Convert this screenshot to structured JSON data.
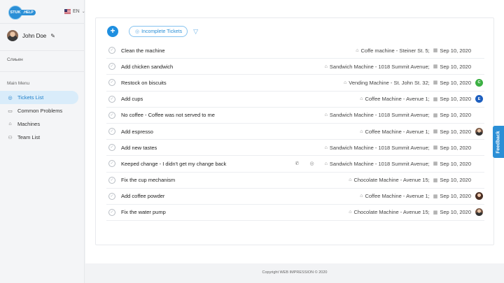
{
  "brand": {
    "badge": "STUK",
    "suffix": ".HELP"
  },
  "language": {
    "code": "EN"
  },
  "user": {
    "name": "John Doe"
  },
  "sidebar": {
    "role": "Слиьен",
    "menu_title": "Main Menu",
    "items": [
      {
        "label": "Tickets List",
        "icon": "check-circle-icon",
        "active": true
      },
      {
        "label": "Common Problems",
        "icon": "folder-icon"
      },
      {
        "label": "Machines",
        "icon": "machine-icon"
      },
      {
        "label": "Team List",
        "icon": "team-icon"
      }
    ]
  },
  "toolbar": {
    "filter_label": "Incomplete Tickets"
  },
  "tickets": [
    {
      "title": "Clean the machine",
      "machine": "Coffe machine - Steiner St. 5;",
      "date": "Sep 10, 2020",
      "assignee": ""
    },
    {
      "title": "Add chicken sandwich",
      "machine": "Sandwich Machine - 1018 Summit Avenue;",
      "date": "Sep 10, 2020",
      "assignee": ""
    },
    {
      "title": "Restock on biscuits",
      "machine": "Vending Machine - St. John St. 32;",
      "date": "Sep 10, 2020",
      "assignee": "C",
      "assignee_color": "#3cb043"
    },
    {
      "title": "Add cups",
      "machine": "Coffee Machine - Avenue 1;",
      "date": "Sep 10, 2020",
      "assignee": "E",
      "assignee_color": "#1e5fbf"
    },
    {
      "title": "No coffee - Coffee was not served to me",
      "machine": "Sandwich Machine - 1018 Summit Avenue;",
      "date": "Sep 10, 2020",
      "assignee": ""
    },
    {
      "title": "Add espresso",
      "machine": "Coffee Machine - Avenue 1;",
      "date": "Sep 10, 2020",
      "assignee": "photo"
    },
    {
      "title": "Add new tastes",
      "machine": "Sandwich Machine - 1018 Summit Avenue;",
      "date": "Sep 10, 2020",
      "assignee": ""
    },
    {
      "title": "Keeped change - I didn't get my change back",
      "machine": "Sandwich Machine - 1018 Summit Avenue;",
      "date": "Sep 10, 2020",
      "assignee": "",
      "extras": true
    },
    {
      "title": "Fix the cup mechanism",
      "machine": "Chocolate Machine - Avenue 15;",
      "date": "Sep 10, 2020",
      "assignee": ""
    },
    {
      "title": "Add coffee powder",
      "machine": "Coffee Machine - Avenue 1;",
      "date": "Sep 10, 2020",
      "assignee": "photo2"
    },
    {
      "title": "Fix the water pump",
      "machine": "Chocolate Machine - Avenue 15;",
      "date": "Sep 10, 2020",
      "assignee": "photo"
    }
  ],
  "footer": {
    "text": "Copyright WEB IMPRESSION © 2020"
  },
  "feedback": {
    "label": "Feedback"
  },
  "colors": {
    "accent": "#2b8fd6",
    "active_bg": "#d9ecfa"
  }
}
